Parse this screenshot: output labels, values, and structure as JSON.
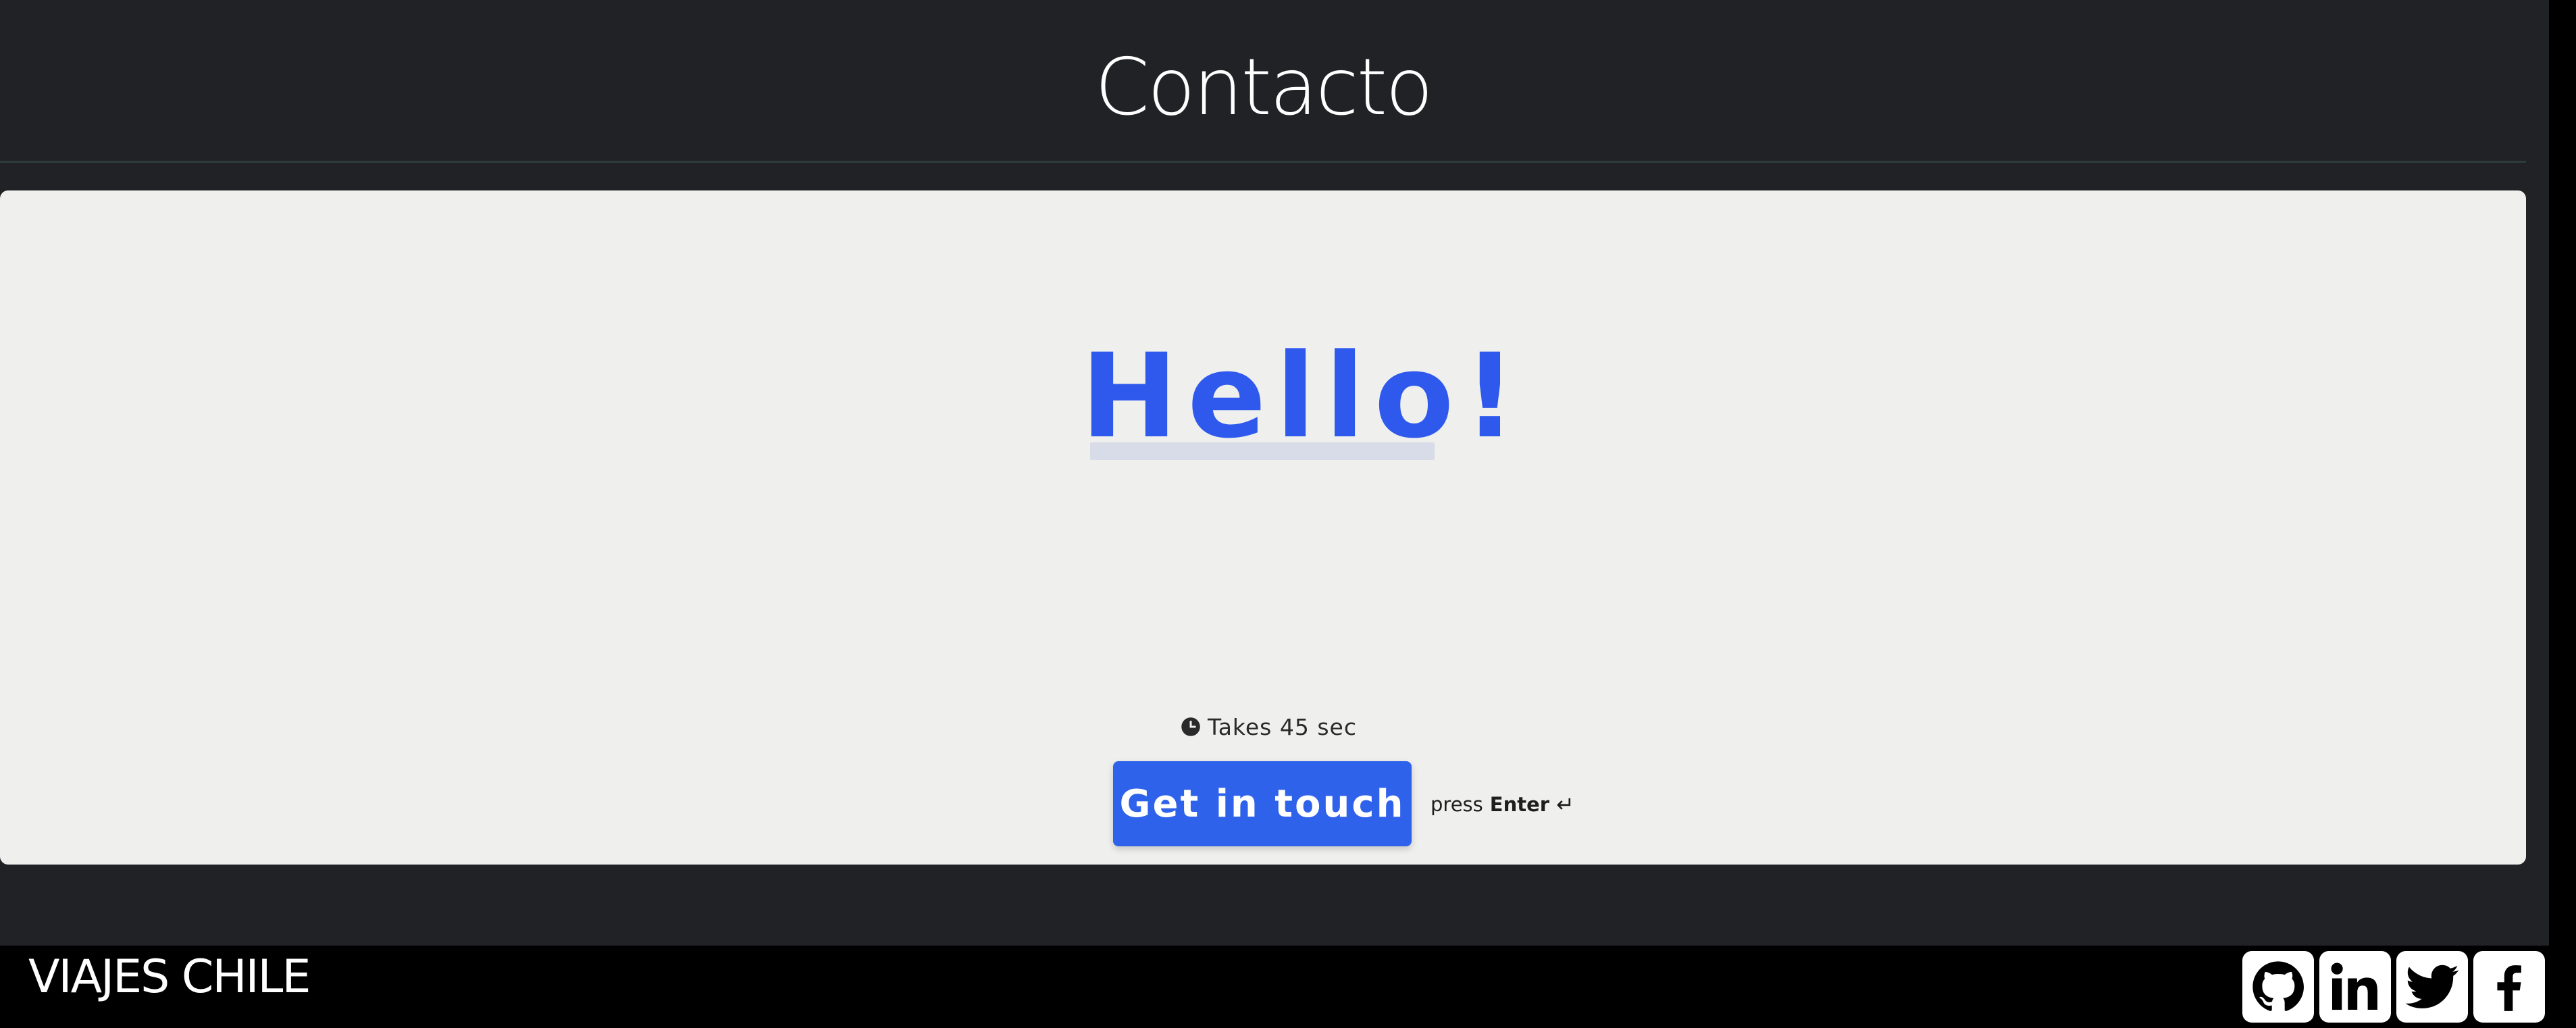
{
  "header": {
    "title": "Contacto"
  },
  "card": {
    "greeting": "Hello!",
    "duration_text": "Takes 45 sec",
    "cta_label": "Get in touch",
    "hint_prefix": "press",
    "hint_key": "Enter",
    "hint_symbol": "↵"
  },
  "footer": {
    "brand": "VIAJES CHILE",
    "social": [
      {
        "name": "github-icon"
      },
      {
        "name": "linkedin-icon"
      },
      {
        "name": "twitter-icon"
      },
      {
        "name": "facebook-icon"
      }
    ]
  },
  "colors": {
    "background": "#212226",
    "card": "#efefed",
    "accent": "#2f59ed",
    "button": "#2f62ea",
    "footer": "#000000"
  }
}
